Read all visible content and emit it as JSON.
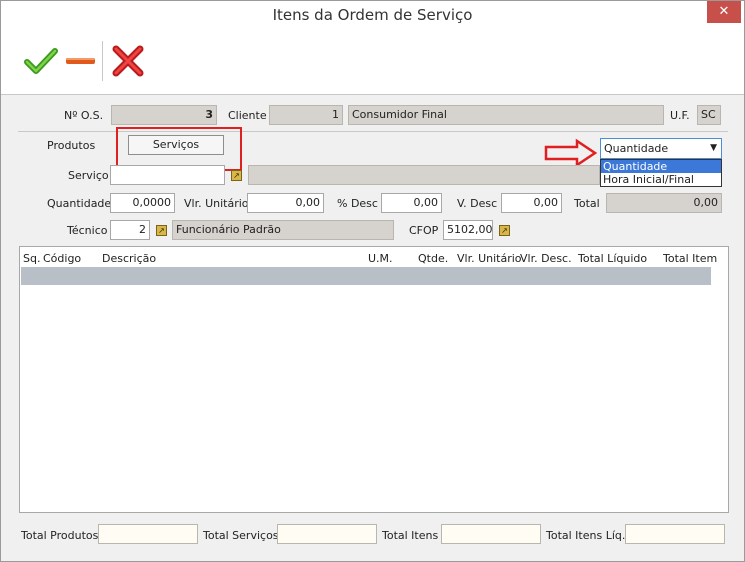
{
  "window": {
    "title": "Itens da Ordem de Serviço",
    "close_glyph": "✕"
  },
  "toolbar": {
    "confirm_icon": "check-icon",
    "remove_icon": "minus-icon",
    "cancel_icon": "x-icon"
  },
  "header": {
    "os_label": "Nº O.S.",
    "os_value": "3",
    "cliente_label": "Cliente",
    "cliente_id": "1",
    "cliente_nome": "Consumidor Final",
    "uf_label": "U.F.",
    "uf_value": "SC"
  },
  "tabs": {
    "produtos": "Produtos",
    "servicos": "Serviços"
  },
  "tipo_select": {
    "selected": "Quantidade",
    "options": [
      "Quantidade",
      "Hora Inicial/Final"
    ]
  },
  "form": {
    "servico_label": "Serviço",
    "servico_value": "",
    "servico_desc": "",
    "quantidade_label": "Quantidade",
    "quantidade_value": "0,0000",
    "vlr_unit_label": "Vlr. Unitário",
    "vlr_unit_value": "0,00",
    "pdesc_label": "% Desc",
    "pdesc_value": "0,00",
    "vdesc_label": "V. Desc",
    "vdesc_value": "0,00",
    "total_label": "Total",
    "total_value": "0,00",
    "tecnico_label": "Técnico",
    "tecnico_id": "2",
    "tecnico_nome": "Funcionário Padrão",
    "cfop_label": "CFOP",
    "cfop_value": "5102,00"
  },
  "grid": {
    "columns": [
      "Sq.",
      "Código",
      "Descrição",
      "U.M.",
      "Qtde.",
      "Vlr. Unitário",
      "Vlr. Desc.",
      "Total Líquido",
      "Total Item"
    ],
    "rows": []
  },
  "footer": {
    "total_produtos_label": "Total Produtos",
    "total_produtos_value": "",
    "total_servicos_label": "Total Serviços",
    "total_servicos_value": "",
    "total_itens_label": "Total Itens",
    "total_itens_value": "",
    "total_itens_liq_label": "Total Itens Líq.",
    "total_itens_liq_value": ""
  },
  "colors": {
    "highlight_red": "#e02020",
    "selection_blue": "#3b78d8",
    "readonly_gray": "#d6d3ce"
  }
}
